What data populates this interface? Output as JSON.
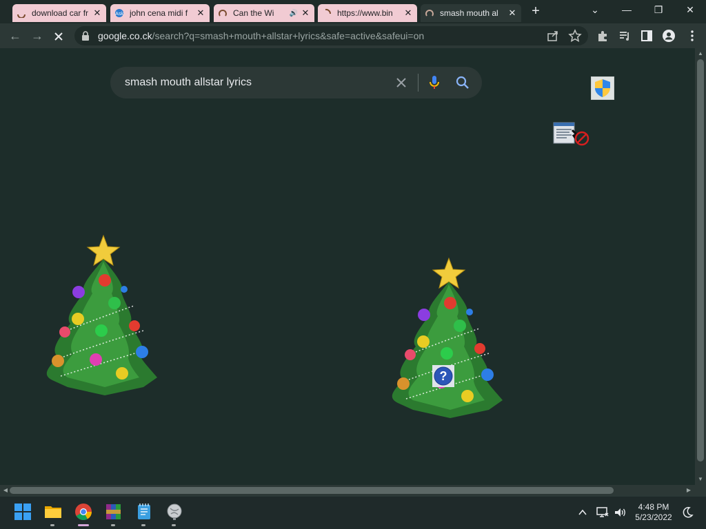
{
  "browser": {
    "tabs": [
      {
        "title": "download car fr",
        "favicon": "loading-spinner-icon"
      },
      {
        "title": "john cena midi f",
        "favicon": "ask-logo-icon"
      },
      {
        "title": "Can the Wi",
        "favicon": "loading-spinner-icon",
        "audio": "speaker-icon"
      },
      {
        "title": "https://www.bin",
        "favicon": "loading-spinner-icon"
      },
      {
        "title": "smash mouth al",
        "favicon": "loading-spinner-icon",
        "active": true
      }
    ],
    "address": {
      "host": "google.co.ck",
      "path": "/search?q=smash+mouth+allstar+lyrics&safe=active&safeui=on"
    }
  },
  "search": {
    "query": "smash mouth allstar lyrics"
  },
  "taskbar": {
    "time": "4:48 PM",
    "date": "5/23/2022"
  },
  "colors": {
    "page_bg": "#1d2d2a",
    "toolbar_bg": "#2c3836",
    "tab_inactive": "#f1cbd3",
    "mic_blue": "#4285f4",
    "mic_red": "#ea4335",
    "mic_yellow": "#fbbc04"
  }
}
